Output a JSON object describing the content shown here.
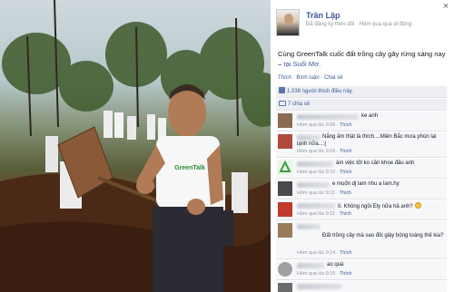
{
  "post": {
    "author": "Trần Lập",
    "meta": "Đã đăng ký theo dõi · Hôm qua qua di động",
    "text_main": "Cùng GreenTalk cuốc đất trồng cây gây rừng sáng nay",
    "text_dash": " – ",
    "location": "tại Suối Mơ.",
    "actions": [
      "Thích",
      "Bình luận",
      "Chia sẻ"
    ],
    "likes": "1.038 người thích điều này.",
    "shares": "7 chia sẻ",
    "close_label": "×"
  },
  "photo": {
    "shirt_text": "GreenTalk"
  },
  "comments": [
    {
      "text": "ke anh",
      "time": "Hôm qua lúc 9:08",
      "like": "Thích",
      "avatar_color": "#8a6b52"
    },
    {
      "text": "Nắng ấm thật là thích....Miền Bắc mưa phùn lại lạnh nữa...:(",
      "time": "Hôm qua lúc 9:09",
      "like": "Thích",
      "avatar_color": "#b14a3a"
    },
    {
      "text": "àm việc tốt ko cần khoe đâu anh",
      "time": "Hôm qua lúc 9:10",
      "like": "Thích",
      "avatar_color": "#3f9c43"
    },
    {
      "text": "e muốn dj lam nhu a lam.hy",
      "time": "Hôm qua lúc 9:11",
      "like": "Thích",
      "avatar_color": "#4a4a4a"
    },
    {
      "text": "ồ. Không ngồi Ely nữa hả anh?",
      "time": "Hôm qua lúc 9:11",
      "like": "Thích",
      "avatar_color": "#c0392b"
    },
    {
      "text": "Đất trồng cây mà sao đôi giày bóng loáng thế kia?",
      "time": "Hôm qua lúc 9:14",
      "like": "Thích",
      "avatar_color": "#9a7b5a"
    },
    {
      "text": "ao quá",
      "time": "Hôm qua lúc 9:15",
      "like": "Thích",
      "avatar_color": "#a0a0a0"
    },
    {
      "text": "",
      "time": "",
      "like": "",
      "avatar_color": "#6b6b6b"
    }
  ]
}
